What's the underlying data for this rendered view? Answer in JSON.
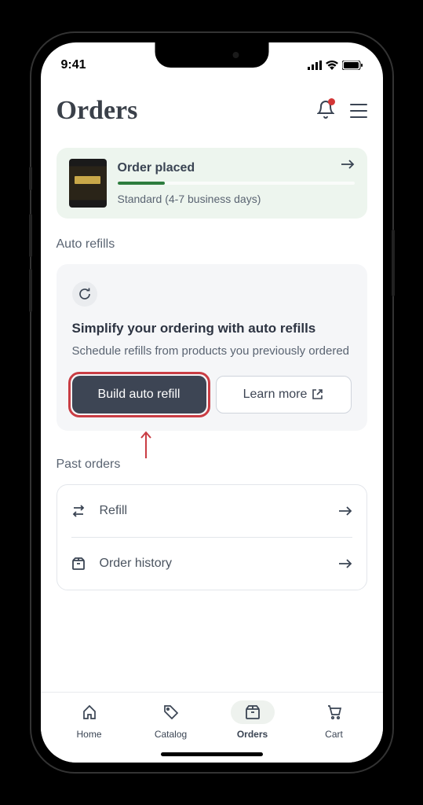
{
  "status_bar": {
    "time": "9:41"
  },
  "header": {
    "title": "Orders"
  },
  "order_placed": {
    "status": "Order placed",
    "shipping": "Standard (4-7 business days)"
  },
  "auto_refills": {
    "section_label": "Auto refills",
    "title": "Simplify your ordering with auto refills",
    "subtitle": "Schedule refills from products you previously ordered",
    "primary_btn": "Build auto refill",
    "secondary_btn": "Learn more"
  },
  "past_orders": {
    "section_label": "Past orders",
    "refill": "Refill",
    "history": "Order history"
  },
  "tabs": {
    "home": "Home",
    "catalog": "Catalog",
    "orders": "Orders",
    "cart": "Cart"
  }
}
